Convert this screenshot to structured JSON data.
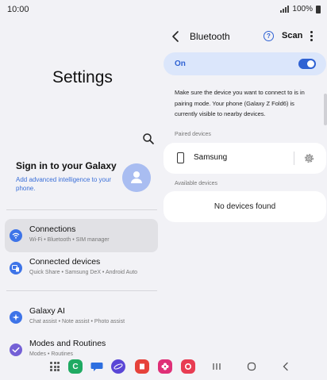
{
  "status_bar": {
    "time": "10:00",
    "battery": "100%"
  },
  "settings": {
    "title": "Settings",
    "profile": {
      "name": "Sign in to your Galaxy",
      "subtitle": "Add advanced intelligence to your phone."
    },
    "menu": [
      {
        "id": "connections",
        "title": "Connections",
        "subtitle": "Wi-Fi  •  Bluetooth  •  SIM manager",
        "icon": "wifi-icon",
        "color": "#3e74e8",
        "selected": true
      },
      {
        "id": "connected-devices",
        "title": "Connected devices",
        "subtitle": "Quick Share  •  Samsung DeX  •  Android Auto",
        "icon": "devices-icon",
        "color": "#3e74e8",
        "selected": false
      },
      {
        "id": "galaxy-ai",
        "title": "Galaxy AI",
        "subtitle": "Chat assist  •  Note assist  •  Photo assist",
        "icon": "sparkle-icon",
        "color": "#3e74e8",
        "selected": false
      },
      {
        "id": "modes-routines",
        "title": "Modes and Routines",
        "subtitle": "Modes  •  Routines",
        "icon": "check-icon",
        "color": "#7460d6",
        "selected": false
      }
    ]
  },
  "bluetooth": {
    "title": "Bluetooth",
    "scan_label": "Scan",
    "toggle_label": "On",
    "toggle_on": true,
    "info": "Make sure the device you want to connect to is in pairing mode. Your phone (Galaxy Z Fold6) is currently visible to nearby devices.",
    "paired_label": "Paired devices",
    "paired_devices": [
      {
        "name": "Samsung",
        "icon": "phone-icon"
      }
    ],
    "available_label": "Available devices",
    "no_devices_text": "No devices found"
  },
  "navbar": {
    "apps": [
      {
        "name": "apps-grid-icon",
        "color": ""
      },
      {
        "name": "phone-app-icon",
        "color": "#1faa62"
      },
      {
        "name": "messages-app-icon",
        "color": "#2d6fe0"
      },
      {
        "name": "internet-app-icon",
        "color": "#5a46d6"
      },
      {
        "name": "notes-app-icon",
        "color": "#e6423a"
      },
      {
        "name": "flower-app-icon",
        "color": "#df2f77"
      },
      {
        "name": "camera-app-icon",
        "color": "#e83c52"
      }
    ]
  },
  "colors": {
    "accent": "#2f62d3",
    "background": "#f2f2f6",
    "card": "#ffffff"
  }
}
